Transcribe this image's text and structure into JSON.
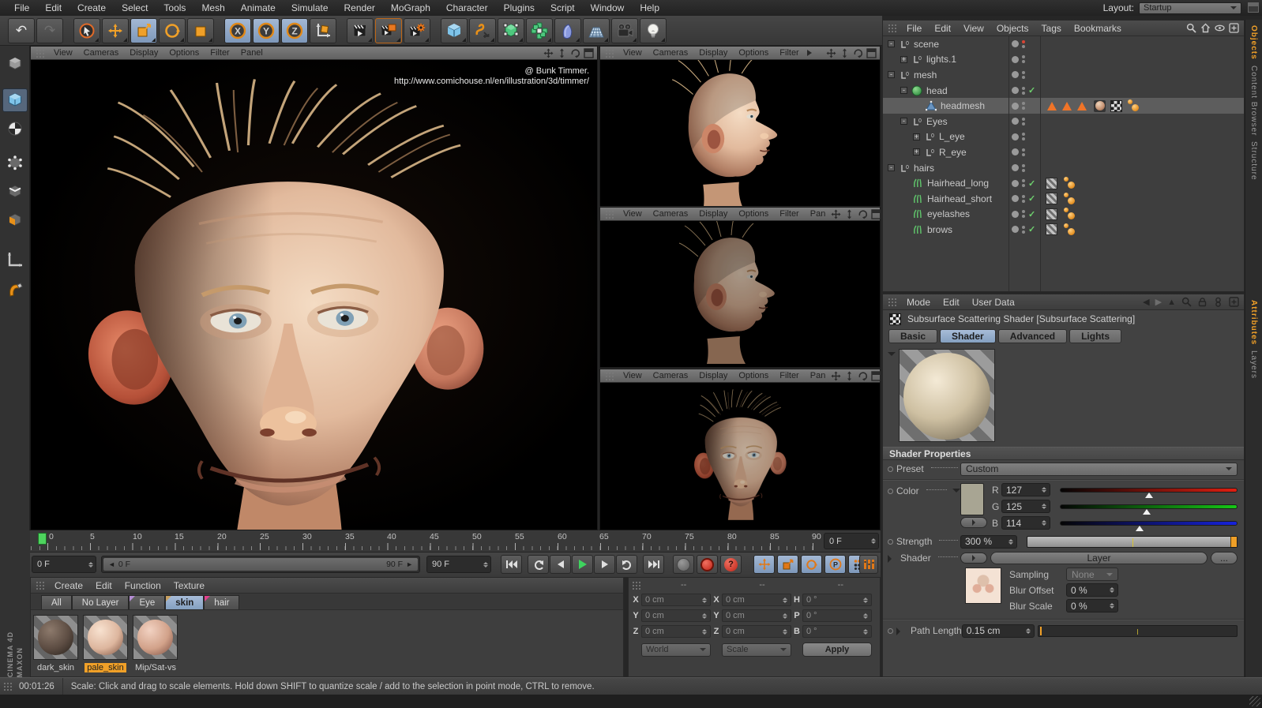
{
  "icons": {
    "undo": "↶",
    "redo": "↷",
    "check": "✓",
    "minus": "-",
    "plus": "+",
    "left_arrow": "◄",
    "right_arrow": "►",
    "back": "◀",
    "forward": "▶",
    "up": "▲",
    "question": "?",
    "p": "P"
  },
  "menubar": {
    "items": [
      "File",
      "Edit",
      "Create",
      "Select",
      "Tools",
      "Mesh",
      "Animate",
      "Simulate",
      "Render",
      "MoGraph",
      "Character",
      "Plugins",
      "Script",
      "Window",
      "Help"
    ],
    "layout_label": "Layout:",
    "layout_value": "Startup"
  },
  "toolbar": {
    "axis": [
      "X",
      "Y",
      "Z"
    ]
  },
  "viewport_main": {
    "menus": [
      "View",
      "Cameras",
      "Display",
      "Options",
      "Filter",
      "Panel"
    ],
    "credit": "@ Bunk Timmer.",
    "credit_url": "http://www.comichouse.nl/en/illustration/3d/timmer/"
  },
  "viewport_right": {
    "menus": [
      "View",
      "Cameras",
      "Display",
      "Options",
      "Filter"
    ],
    "pan": "Pan"
  },
  "object_manager": {
    "menus": [
      "File",
      "Edit",
      "View",
      "Objects",
      "Tags",
      "Bookmarks"
    ],
    "tree": [
      {
        "label": "scene"
      },
      {
        "label": "lights.1"
      },
      {
        "label": "mesh"
      },
      {
        "label": "head"
      },
      {
        "label": "headmesh"
      },
      {
        "label": "Eyes"
      },
      {
        "label": "L_eye"
      },
      {
        "label": "R_eye"
      },
      {
        "label": "hairs"
      },
      {
        "label": "Hairhead_long"
      },
      {
        "label": "Hairhead_short"
      },
      {
        "label": "eyelashes"
      },
      {
        "label": "brows"
      }
    ]
  },
  "side_tabs": {
    "top": [
      "Objects",
      "Content Browser",
      "Structure"
    ],
    "bottom": [
      "Attributes",
      "Layers"
    ]
  },
  "attributes": {
    "menus": [
      "Mode",
      "Edit",
      "User Data"
    ],
    "title": "Subsurface Scattering Shader [Subsurface Scattering]",
    "tabs": [
      "Basic",
      "Shader",
      "Advanced",
      "Lights"
    ],
    "section": "Shader Properties",
    "preset_label": "Preset",
    "preset_value": "Custom",
    "color_label": "Color",
    "r_label": "R",
    "r_value": "127",
    "g_label": "G",
    "g_value": "125",
    "b_label": "B",
    "b_value": "114",
    "strength_label": "Strength",
    "strength_value": "300 %",
    "shader_label": "Shader",
    "shader_button": "Layer",
    "shader_more": "...",
    "sampling_label": "Sampling",
    "sampling_value": "None",
    "blur_offset_label": "Blur Offset",
    "blur_offset_value": "0 %",
    "blur_scale_label": "Blur Scale",
    "blur_scale_value": "0 %",
    "path_label": "Path Length",
    "path_value": "0.15 cm"
  },
  "timeline": {
    "ticks": [
      "0",
      "5",
      "10",
      "15",
      "20",
      "25",
      "30",
      "35",
      "40",
      "45",
      "50",
      "55",
      "60",
      "65",
      "70",
      "75",
      "80",
      "85",
      "90"
    ],
    "current": "0 F",
    "range_start": "0 F",
    "range_end": "90 F",
    "end_value": "90 F"
  },
  "materials": {
    "menus": [
      "Create",
      "Edit",
      "Function",
      "Texture"
    ],
    "tabs": [
      "All",
      "No Layer",
      "Eye",
      "skin",
      "hair"
    ],
    "items": [
      "dark_skin",
      "pale_skin",
      "Mip/Sat-vs"
    ]
  },
  "coordinates": {
    "headers": [
      "--",
      "--",
      "--"
    ],
    "pos_labels": [
      "X",
      "Y",
      "Z"
    ],
    "pos_values": [
      "0 cm",
      "0 cm",
      "0 cm"
    ],
    "size_labels": [
      "X",
      "Y",
      "Z"
    ],
    "size_values": [
      "0 cm",
      "0 cm",
      "0 cm"
    ],
    "rot_labels": [
      "H",
      "P",
      "B"
    ],
    "rot_values": [
      "0 °",
      "0 °",
      "0 °"
    ],
    "world": "World",
    "scale": "Scale",
    "apply": "Apply"
  },
  "statusbar": {
    "time": "00:01:26",
    "message": "Scale: Click and drag to scale elements. Hold down SHIFT to quantize scale / add to the selection in point mode, CTRL to remove."
  },
  "branding": {
    "line1": "MAXON",
    "line2": "CINEMA 4D"
  },
  "colors": {
    "accent_orange": "#f0a028",
    "selection_blue": "#8ba6c7",
    "record_red": "#e04038",
    "check_green": "#6ed06e",
    "playhead_green": "#4ed45e",
    "swatch": "#a8a593"
  }
}
